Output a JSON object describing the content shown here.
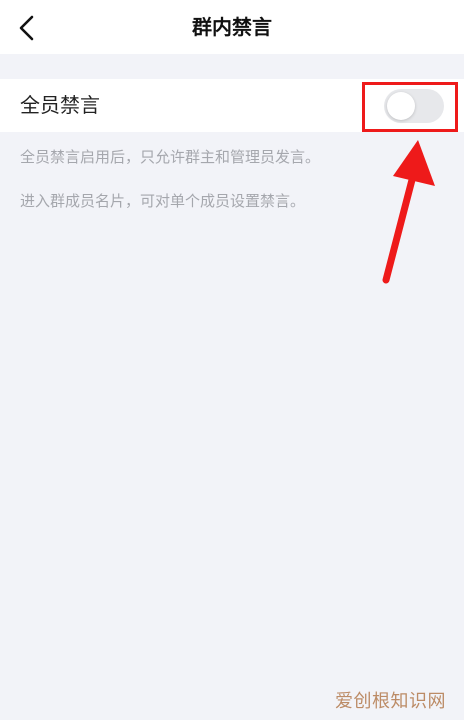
{
  "header": {
    "title": "群内禁言",
    "back_icon": "chevron-left-icon"
  },
  "settings": {
    "mute_all": {
      "label": "全员禁言",
      "enabled": false
    },
    "description_1": "全员禁言启用后，只允许群主和管理员发言。",
    "description_2": "进入群成员名片，可对单个成员设置禁言。"
  },
  "annotation": {
    "highlight_color": "#ee1a1a",
    "arrow_color": "#ee1a1a"
  },
  "watermark": "爱创根知识网"
}
